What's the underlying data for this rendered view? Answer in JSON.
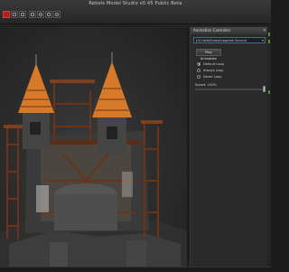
{
  "window": {
    "title": "Rebels Model Studio v0.45 Public Beta"
  },
  "toolbar": {
    "icons": [
      "close-icon",
      "save-icon",
      "open-icon",
      "grid-icon",
      "camera-icon",
      "light-icon",
      "settings-icon"
    ]
  },
  "panel": {
    "title": "Animation Controller",
    "close_glyph": "×",
    "animation_select": "[0] Hold/Shake/Upgrade Second",
    "dropdown_arrow": "▾",
    "play_label": "Play Animation",
    "loop_options": [
      {
        "label": "Default Loop",
        "selected": true
      },
      {
        "label": "Always Loop",
        "selected": false
      },
      {
        "label": "Never Loop",
        "selected": false
      }
    ],
    "speed_label": "Speed: 100%",
    "speed_value_percent": 100
  },
  "colors": {
    "wood": "#6a3418",
    "roof_orange": "#d67a2a",
    "stone": "#3a3a3a",
    "accent_green": "#4d8a3a",
    "close_red": "#b02020"
  }
}
